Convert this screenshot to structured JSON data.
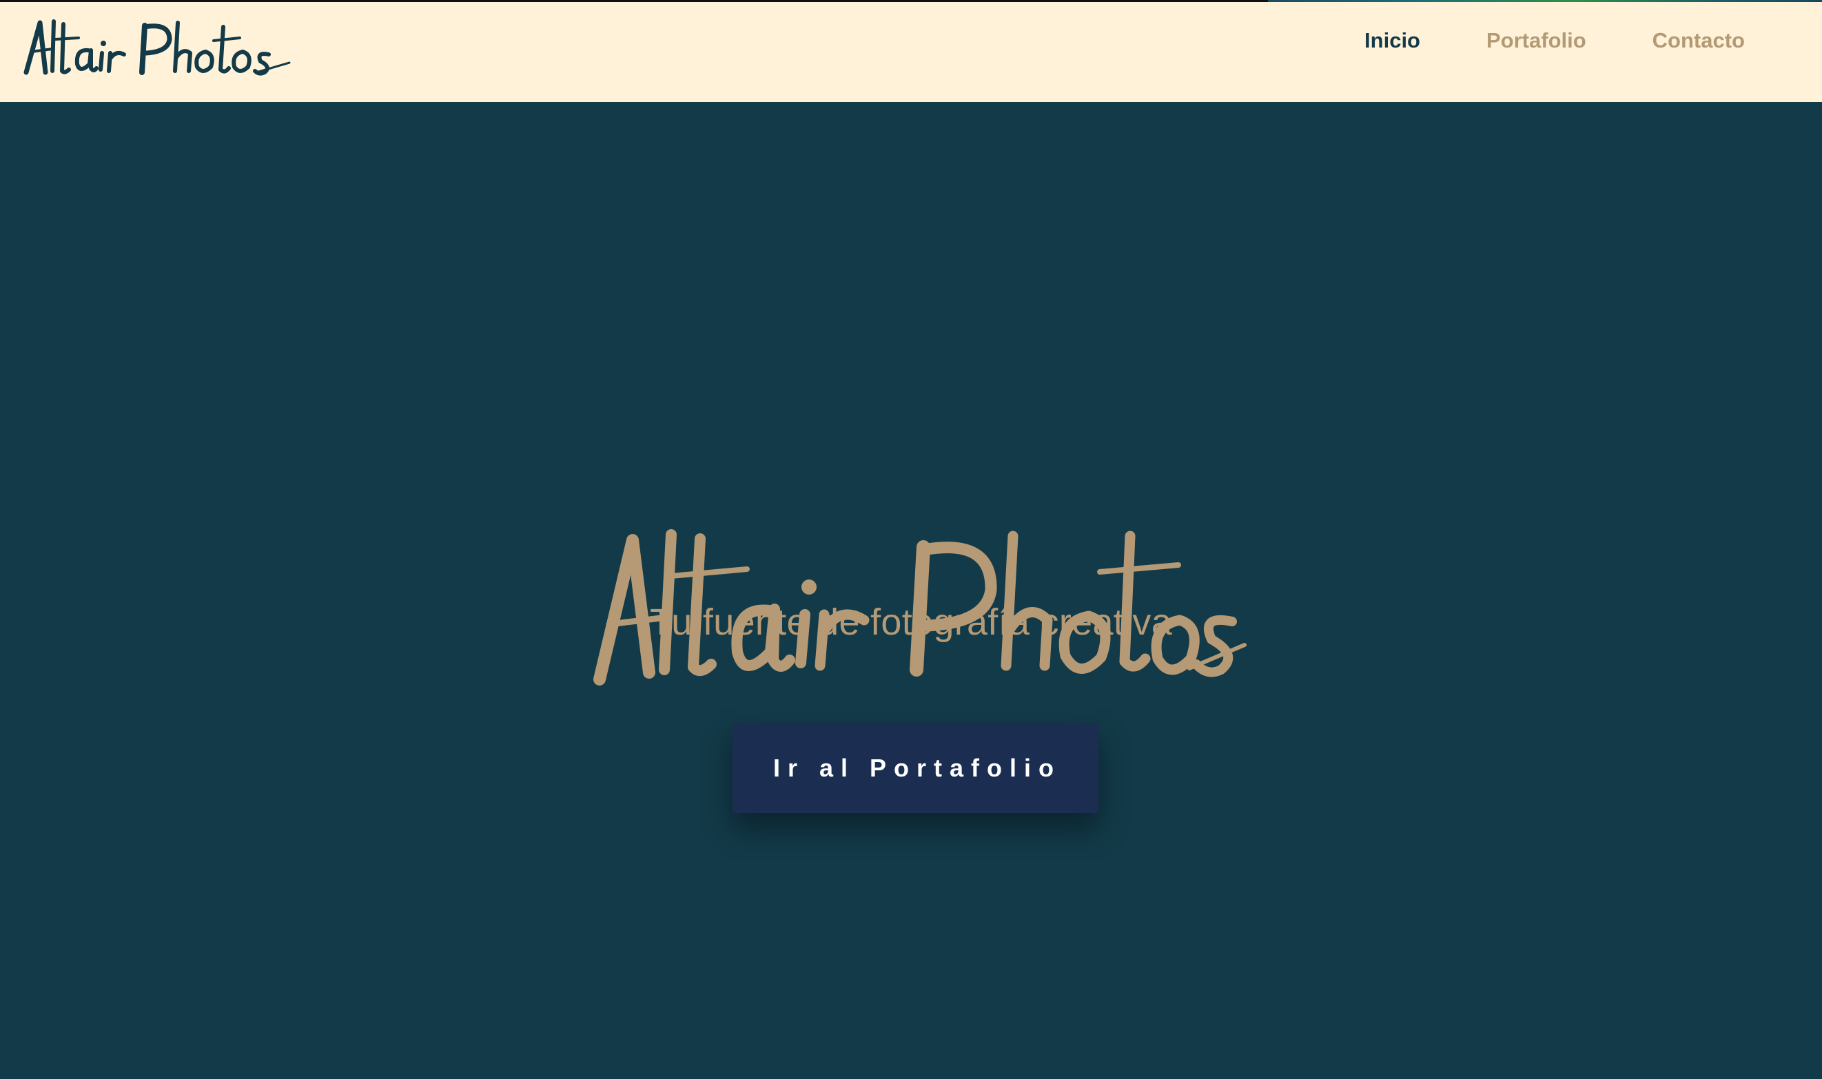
{
  "brand": {
    "name": "Altair Photos",
    "logo_color": "#133a48",
    "hero_logo_color": "#b59a75"
  },
  "nav": {
    "items": [
      {
        "label": "Inicio",
        "active": true
      },
      {
        "label": "Portafolio",
        "active": false
      },
      {
        "label": "Contacto",
        "active": false
      }
    ]
  },
  "hero": {
    "subtitle": "Tu fuente de fotografía creativa",
    "cta_label": "Ir al Portafolio"
  },
  "colors": {
    "navbar_bg": "#fff2d8",
    "hero_bg": "#133a48",
    "accent": "#b59a75",
    "button_bg": "#1b2e52",
    "button_text": "#ffffff"
  }
}
